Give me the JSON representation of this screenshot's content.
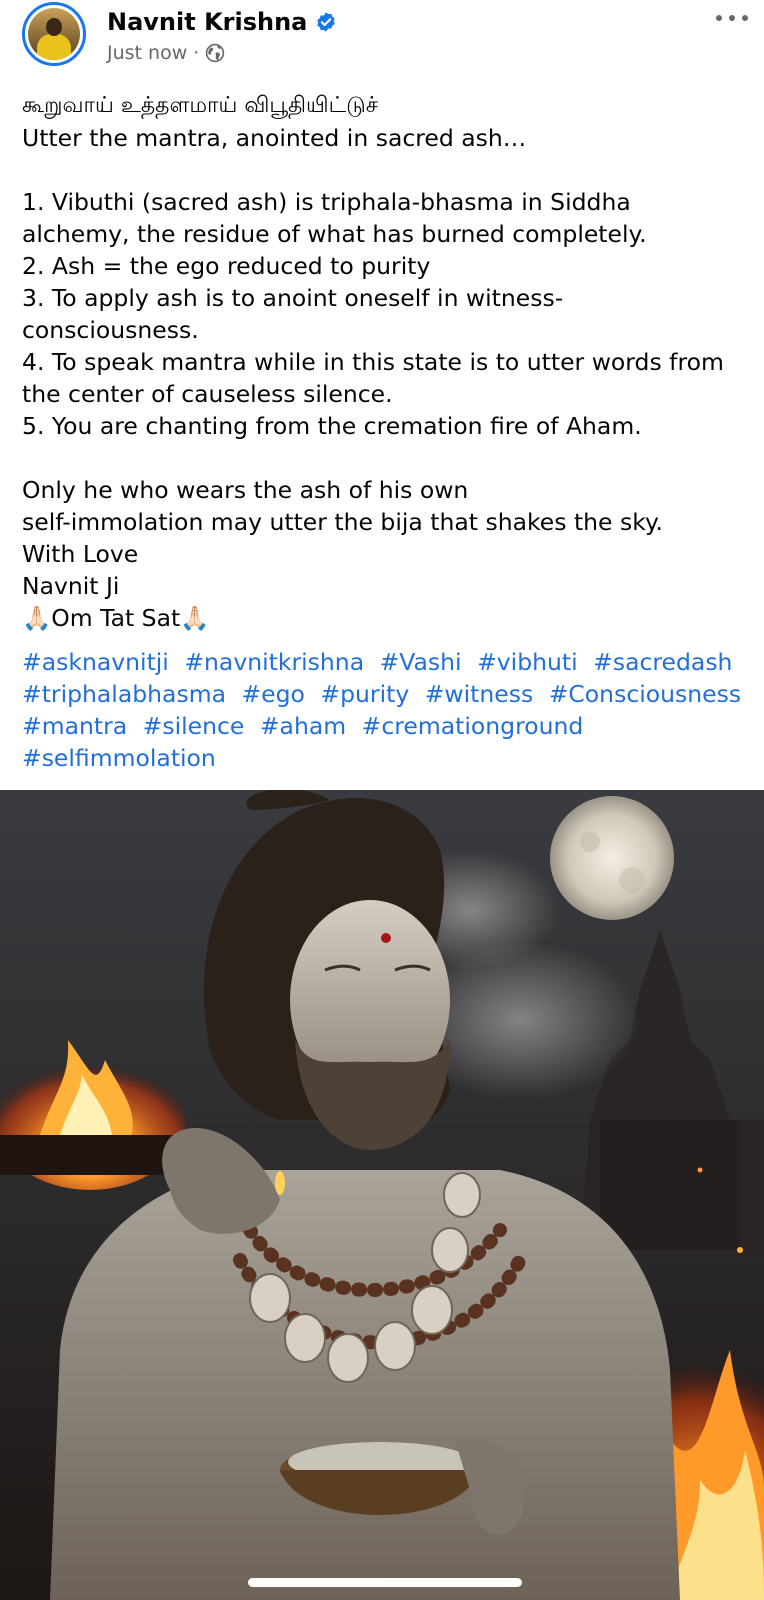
{
  "author": {
    "name": "Navnit Krishna",
    "verified": true,
    "timestamp": "Just now",
    "separator": "·",
    "audience_icon": "globe-icon"
  },
  "menu": {
    "icon": "more-options-icon"
  },
  "caption": {
    "lines": [
      "கூறுவாய் உத்தளமாய் விபூதியிட்டுச்",
      "Utter the mantra, anointed in sacred ash…",
      "",
      "1. Vibuthi (sacred ash) is triphala-bhasma in Siddha",
      "alchemy, the residue of what has burned completely.",
      "2. Ash = the ego reduced to purity",
      "3. To apply ash is to anoint oneself in witness-",
      "consciousness.",
      "4. To speak mantra while in this state is to utter words from",
      "the center of causeless silence.",
      "5. You are chanting from the cremation fire of Aham.",
      "",
      "Only he who wears the ash of his own",
      "self-immolation may utter the bija that shakes the sky.",
      "With Love",
      "Navnit Ji",
      "🙏🏻Om Tat Sat🙏🏻"
    ]
  },
  "hashtags": {
    "line1": [
      "#asknavnitji",
      "#navnitkrishna",
      "#Vashi",
      "#vibhuti",
      "#sacredash"
    ],
    "line2": [
      "#triphalabhasma",
      "#ego",
      "#purity",
      "#witness",
      "#Consciousness"
    ],
    "line3": [
      "#mantra",
      "#silence",
      "#aham",
      "#cremationground"
    ],
    "line4": [
      "#selfimmolation"
    ]
  },
  "colors": {
    "accent": "#1877f2",
    "hashtag": "#216fdb",
    "text": "#050505",
    "meta": "#65676b"
  }
}
